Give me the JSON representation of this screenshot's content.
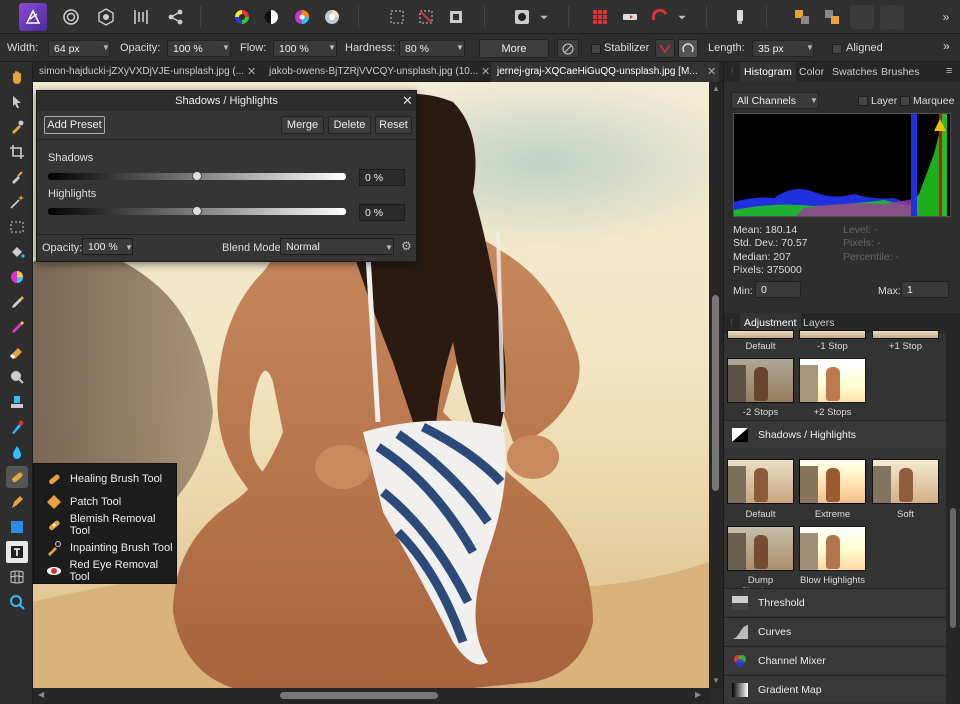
{
  "toolbar": {
    "icons": [
      "affinity-logo-icon",
      "persona-photo-icon",
      "persona-liquify-icon",
      "persona-develop-icon",
      "persona-tone-map-icon",
      "persona-export-icon",
      "color-wheel-icon",
      "contrast-icon",
      "saturation-icon",
      "white-balance-icon",
      "marquee-icon",
      "no-selection-icon",
      "invert-selection-icon",
      "quick-mask-icon",
      "snapping-icon",
      "assistant-icon",
      "transform-icon",
      "arrange-icon",
      "align-icon",
      "more-icon"
    ]
  },
  "context": {
    "width_label": "Width:",
    "width_value": "64 px",
    "opacity_label": "Opacity:",
    "opacity_value": "100 %",
    "flow_label": "Flow:",
    "flow_value": "100 %",
    "hardness_label": "Hardness:",
    "hardness_value": "80 %",
    "more_label": "More",
    "stabilizer_label": "Stabilizer",
    "length_label": "Length:",
    "length_value": "35 px",
    "aligned_label": "Aligned"
  },
  "tabs": [
    {
      "label": "simon-hajducki-jZXyVXDjVJE-unsplash.jpg (..."
    },
    {
      "label": "jakob-owens-BjTZRjVVCQY-unsplash.jpg (10..."
    },
    {
      "label": "jernej-graj-XQCaeHiGuQQ-unsplash.jpg [M..."
    }
  ],
  "dialog": {
    "title": "Shadows / Highlights",
    "add_preset": "Add Preset",
    "merge": "Merge",
    "delete": "Delete",
    "reset": "Reset",
    "shadows_label": "Shadows",
    "shadows_value": "0 %",
    "shadows_level": 0.5,
    "highlights_label": "Highlights",
    "highlights_value": "0 %",
    "highlights_level": 0.5,
    "opacity_label": "Opacity:",
    "opacity_value": "100 %",
    "blend_label": "Blend Mode:",
    "blend_value": "Normal"
  },
  "flyout": [
    {
      "label": "Healing Brush Tool",
      "icon": "healing-brush-icon"
    },
    {
      "label": "Patch Tool",
      "icon": "patch-tool-icon"
    },
    {
      "label": "Blemish Removal Tool",
      "icon": "blemish-removal-icon"
    },
    {
      "label": "Inpainting Brush Tool",
      "icon": "inpainting-brush-icon"
    },
    {
      "label": "Red Eye Removal Tool",
      "icon": "red-eye-icon"
    }
  ],
  "panel_tabs": [
    "Histogram",
    "Color",
    "Swatches",
    "Brushes"
  ],
  "histogram": {
    "channel": "All Channels",
    "layer_label": "Layer",
    "marquee_label": "Marquee",
    "mean": "Mean: 180.14",
    "std": "Std. Dev.: 70.57",
    "median": "Median: 207",
    "pixels": "Pixels: 375000",
    "level": "Level: -",
    "count": "Pixels: -",
    "percentile": "Percentile: -",
    "min_label": "Min:",
    "min_value": "0",
    "max_label": "Max:",
    "max_value": "1",
    "colors": {
      "red": "#d01010",
      "green": "#20c020",
      "blue": "#2030e0",
      "warning": "#f0c000"
    }
  },
  "adjust_tabs": [
    "Adjustment",
    "Layers"
  ],
  "adjust": {
    "top_labels": [
      "Default",
      "-1 Stop",
      "+1 Stop"
    ],
    "row2_labels": [
      "-2 Stops",
      "+2 Stops"
    ],
    "section": "Shadows / Highlights",
    "thumbs_labels": [
      "Default",
      "Extreme",
      "Soft"
    ],
    "thumbs2_labels": [
      "Dump Shadows",
      "Blow Highlights"
    ],
    "items": [
      "Threshold",
      "Curves",
      "Channel Mixer",
      "Gradient Map"
    ]
  }
}
